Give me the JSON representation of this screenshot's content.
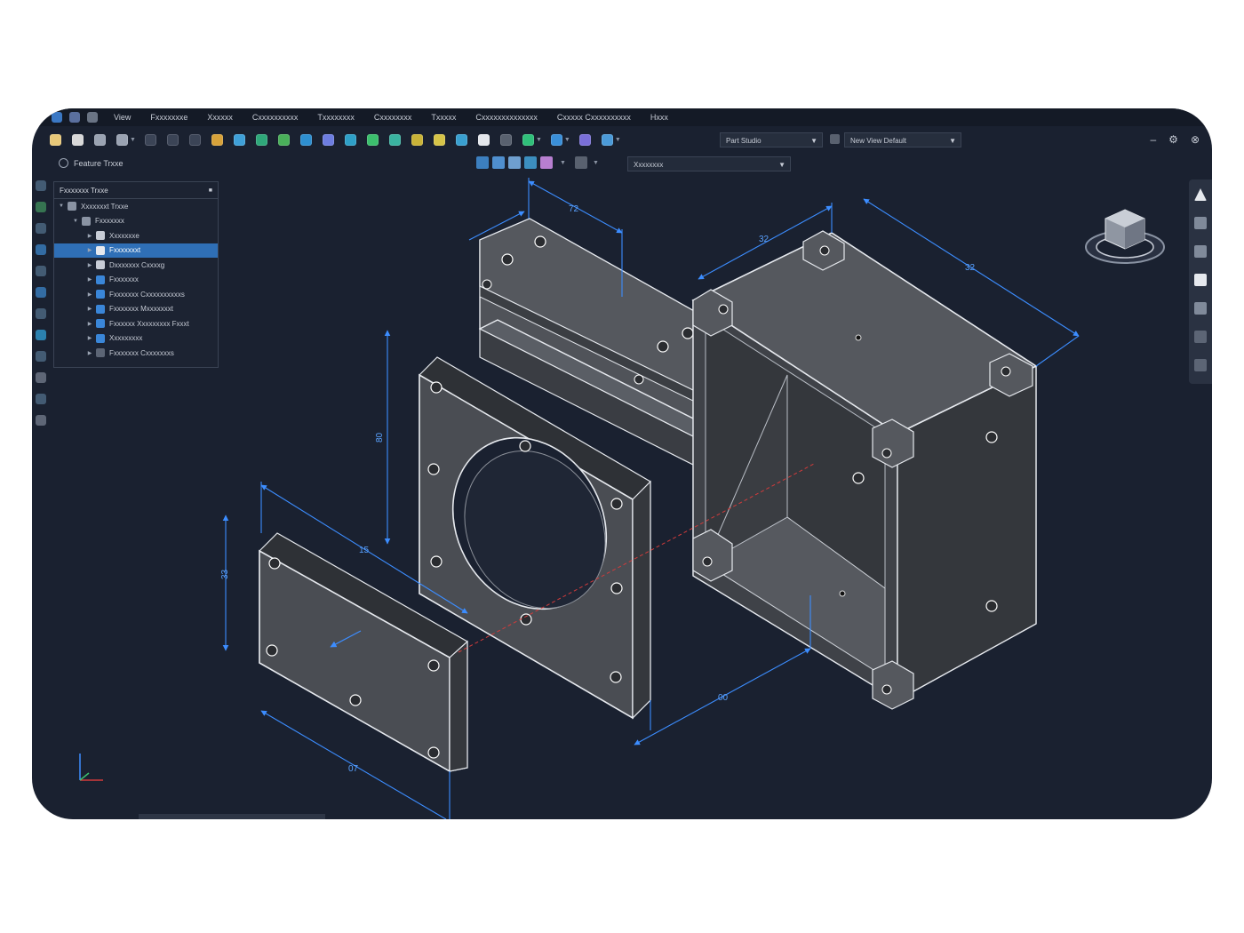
{
  "menu": {
    "items": [
      "View",
      "Fxxxxxxxe",
      "Xxxxxx",
      "Cxxxxxxxxxx",
      "Txxxxxxxx",
      "Cxxxxxxxx",
      "Txxxxx",
      "Cxxxxxxxxxxxxxx",
      "Cxxxxx Cxxxxxxxxxx",
      "Hxxx"
    ]
  },
  "toolbar": {
    "studio_dropdown": "Part Studio",
    "view_dropdown": "New View Default"
  },
  "subtoolbar": {
    "dropdown": "Xxxxxxxx"
  },
  "feature_tree": {
    "label": "Feature Trxxe",
    "panel_title": "Fxxxxxxx Trxxe",
    "rows": [
      {
        "label": "Xxxxxxxt Trxxe",
        "level": 0,
        "icon": "assembly-icon",
        "selected": false
      },
      {
        "label": "Fxxxxxxx",
        "level": 1,
        "icon": "gear-icon",
        "selected": false
      },
      {
        "label": "Xxxxxxxe",
        "level": 2,
        "icon": "document-icon",
        "selected": false
      },
      {
        "label": "Fxxxxxxxt",
        "level": 2,
        "icon": "sketch-icon",
        "selected": true
      },
      {
        "label": "Dxxxxxxx Cxxxxg",
        "level": 2,
        "icon": "document-icon",
        "selected": false
      },
      {
        "label": "Fxxxxxxx",
        "level": 2,
        "icon": "feature-icon",
        "selected": false
      },
      {
        "label": "Fxxxxxxx Cxxxxxxxxxxs",
        "level": 2,
        "icon": "feature-icon",
        "selected": false
      },
      {
        "label": "Fxxxxxxx Mxxxxxxxt",
        "level": 2,
        "icon": "feature-icon",
        "selected": false
      },
      {
        "label": "Fxxxxxx Xxxxxxxxx Fxxxt",
        "level": 2,
        "icon": "feature-icon",
        "selected": false
      },
      {
        "label": "Xxxxxxxxx",
        "level": 2,
        "icon": "feature-icon",
        "selected": false
      },
      {
        "label": "Fxxxxxxx Cxxxxxxxs",
        "level": 2,
        "icon": "history-icon",
        "selected": false
      }
    ]
  },
  "dimensions": {
    "top_width": "72",
    "housing_top_short": "32",
    "housing_top_long": "32",
    "plate_height": "80",
    "cover_width": "15",
    "cover_height": "33",
    "cover_length": "07",
    "housing_bottom": "00"
  },
  "colors": {
    "background": "#1a2130",
    "accent": "#2f6fb6",
    "dimension_line": "#3c8dff",
    "part_fill": "#4b4e54",
    "part_edge": "#e6e9ee"
  }
}
